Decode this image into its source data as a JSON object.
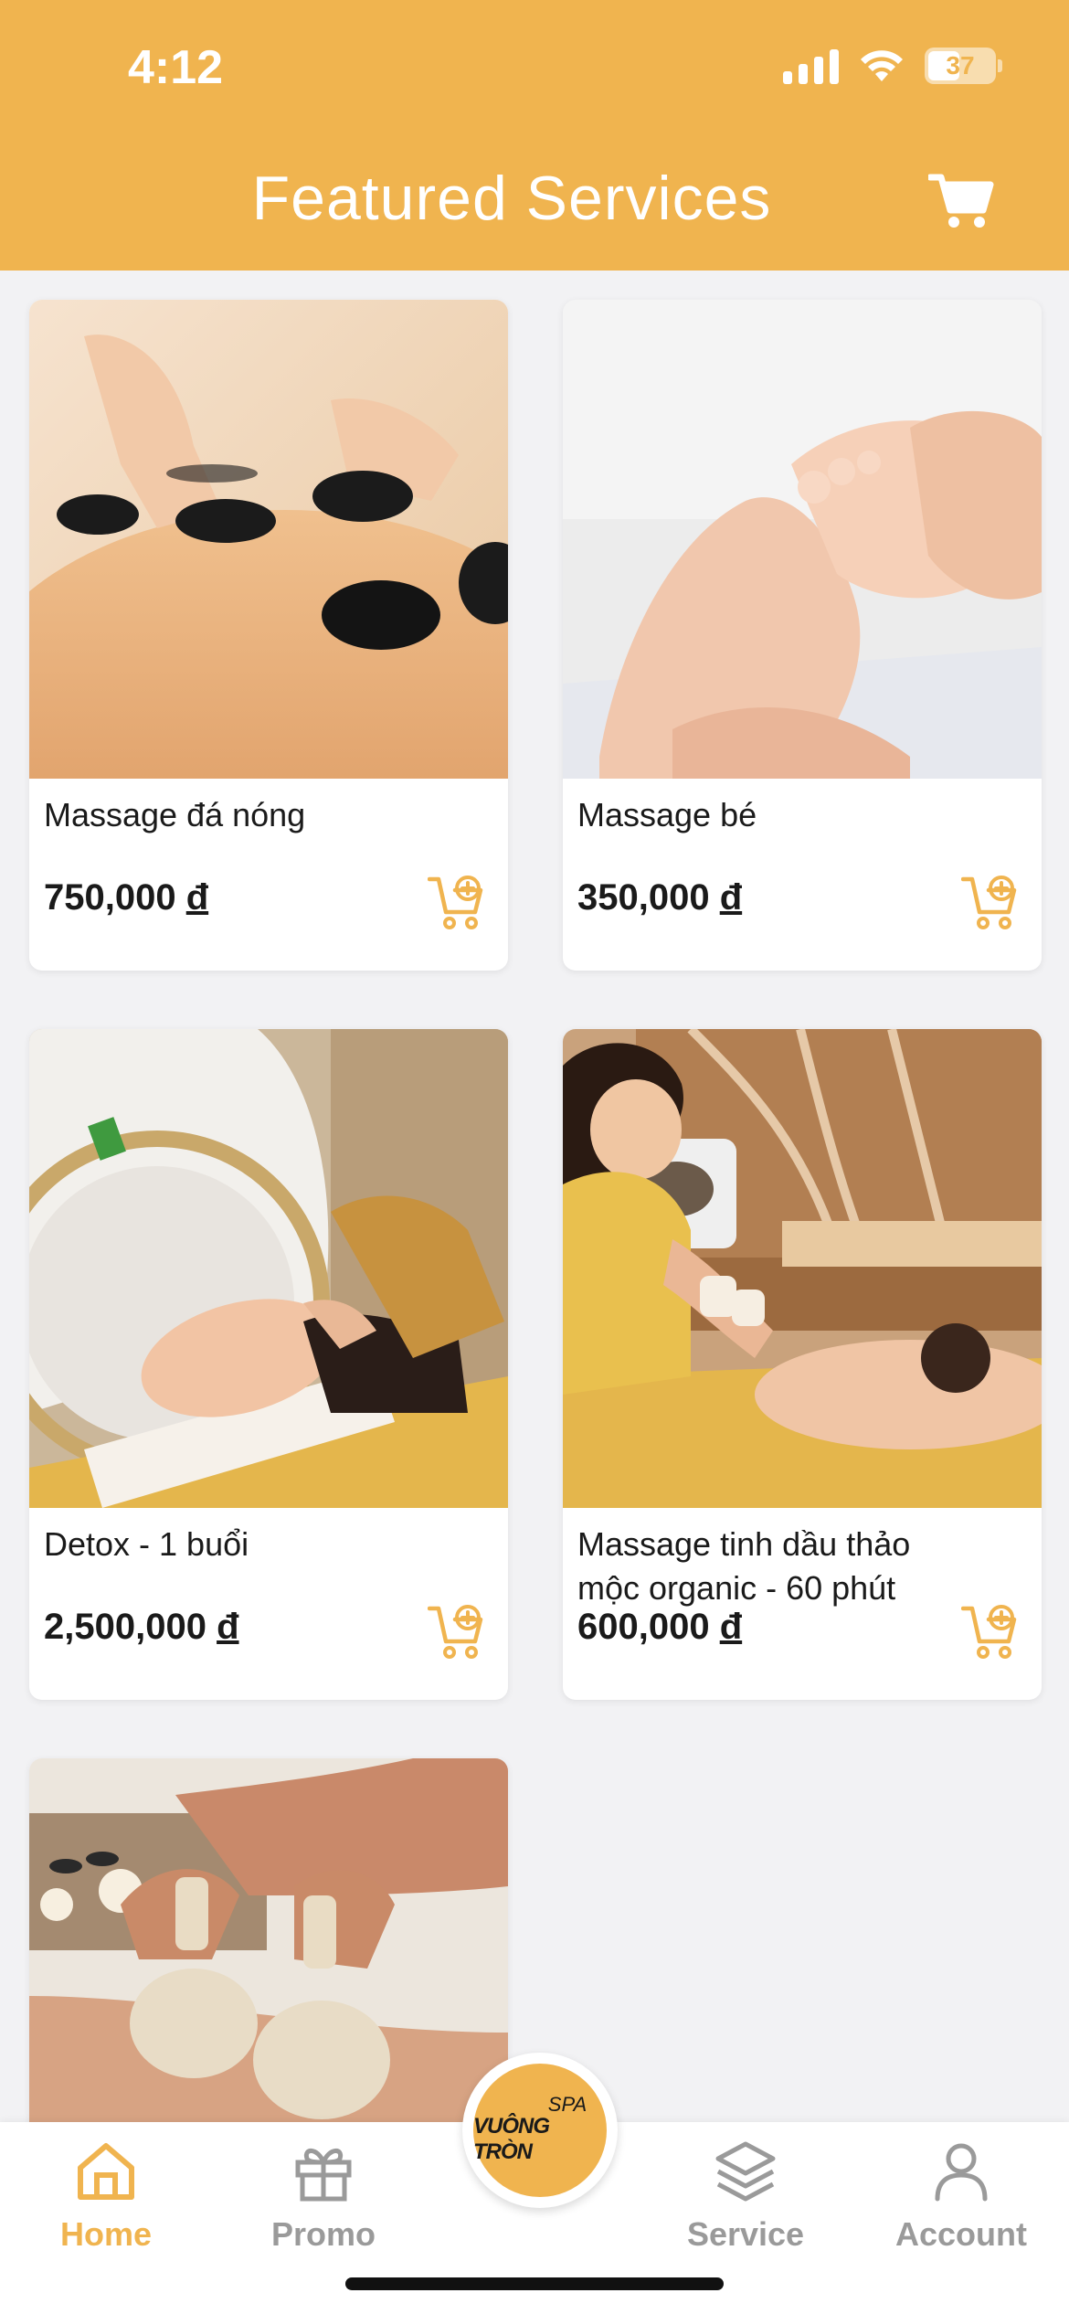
{
  "status_bar": {
    "time": "4:12",
    "battery": "37"
  },
  "header": {
    "title": "Featured Services",
    "accent_color": "#f0b44f"
  },
  "services": [
    {
      "name": "Massage đá nóng",
      "price": "750,000",
      "currency": "đ",
      "image": "hot-stone-massage-photo"
    },
    {
      "name": "Massage bé",
      "price": "350,000",
      "currency": "đ",
      "image": "baby-foot-massage-photo"
    },
    {
      "name": "Detox - 1 buổi",
      "price": "2,500,000",
      "currency": "đ",
      "image": "detox-face-massage-photo"
    },
    {
      "name": "Massage tinh dầu thảo mộc organic - 60 phút",
      "price": "600,000",
      "currency": "đ",
      "image": "herbal-oil-massage-photo"
    },
    {
      "name": "",
      "price": "",
      "currency": "",
      "image": "herbal-compress-massage-photo"
    }
  ],
  "bottom_nav": {
    "items": [
      {
        "label": "Home",
        "icon": "home-icon",
        "active": true
      },
      {
        "label": "Promo",
        "icon": "gift-icon",
        "active": false
      },
      {
        "label": "Service",
        "icon": "layers-icon",
        "active": false
      },
      {
        "label": "Account",
        "icon": "user-icon",
        "active": false
      }
    ],
    "center_logo": {
      "small": "SPA",
      "main": "VUÔNG TRÒN"
    }
  }
}
